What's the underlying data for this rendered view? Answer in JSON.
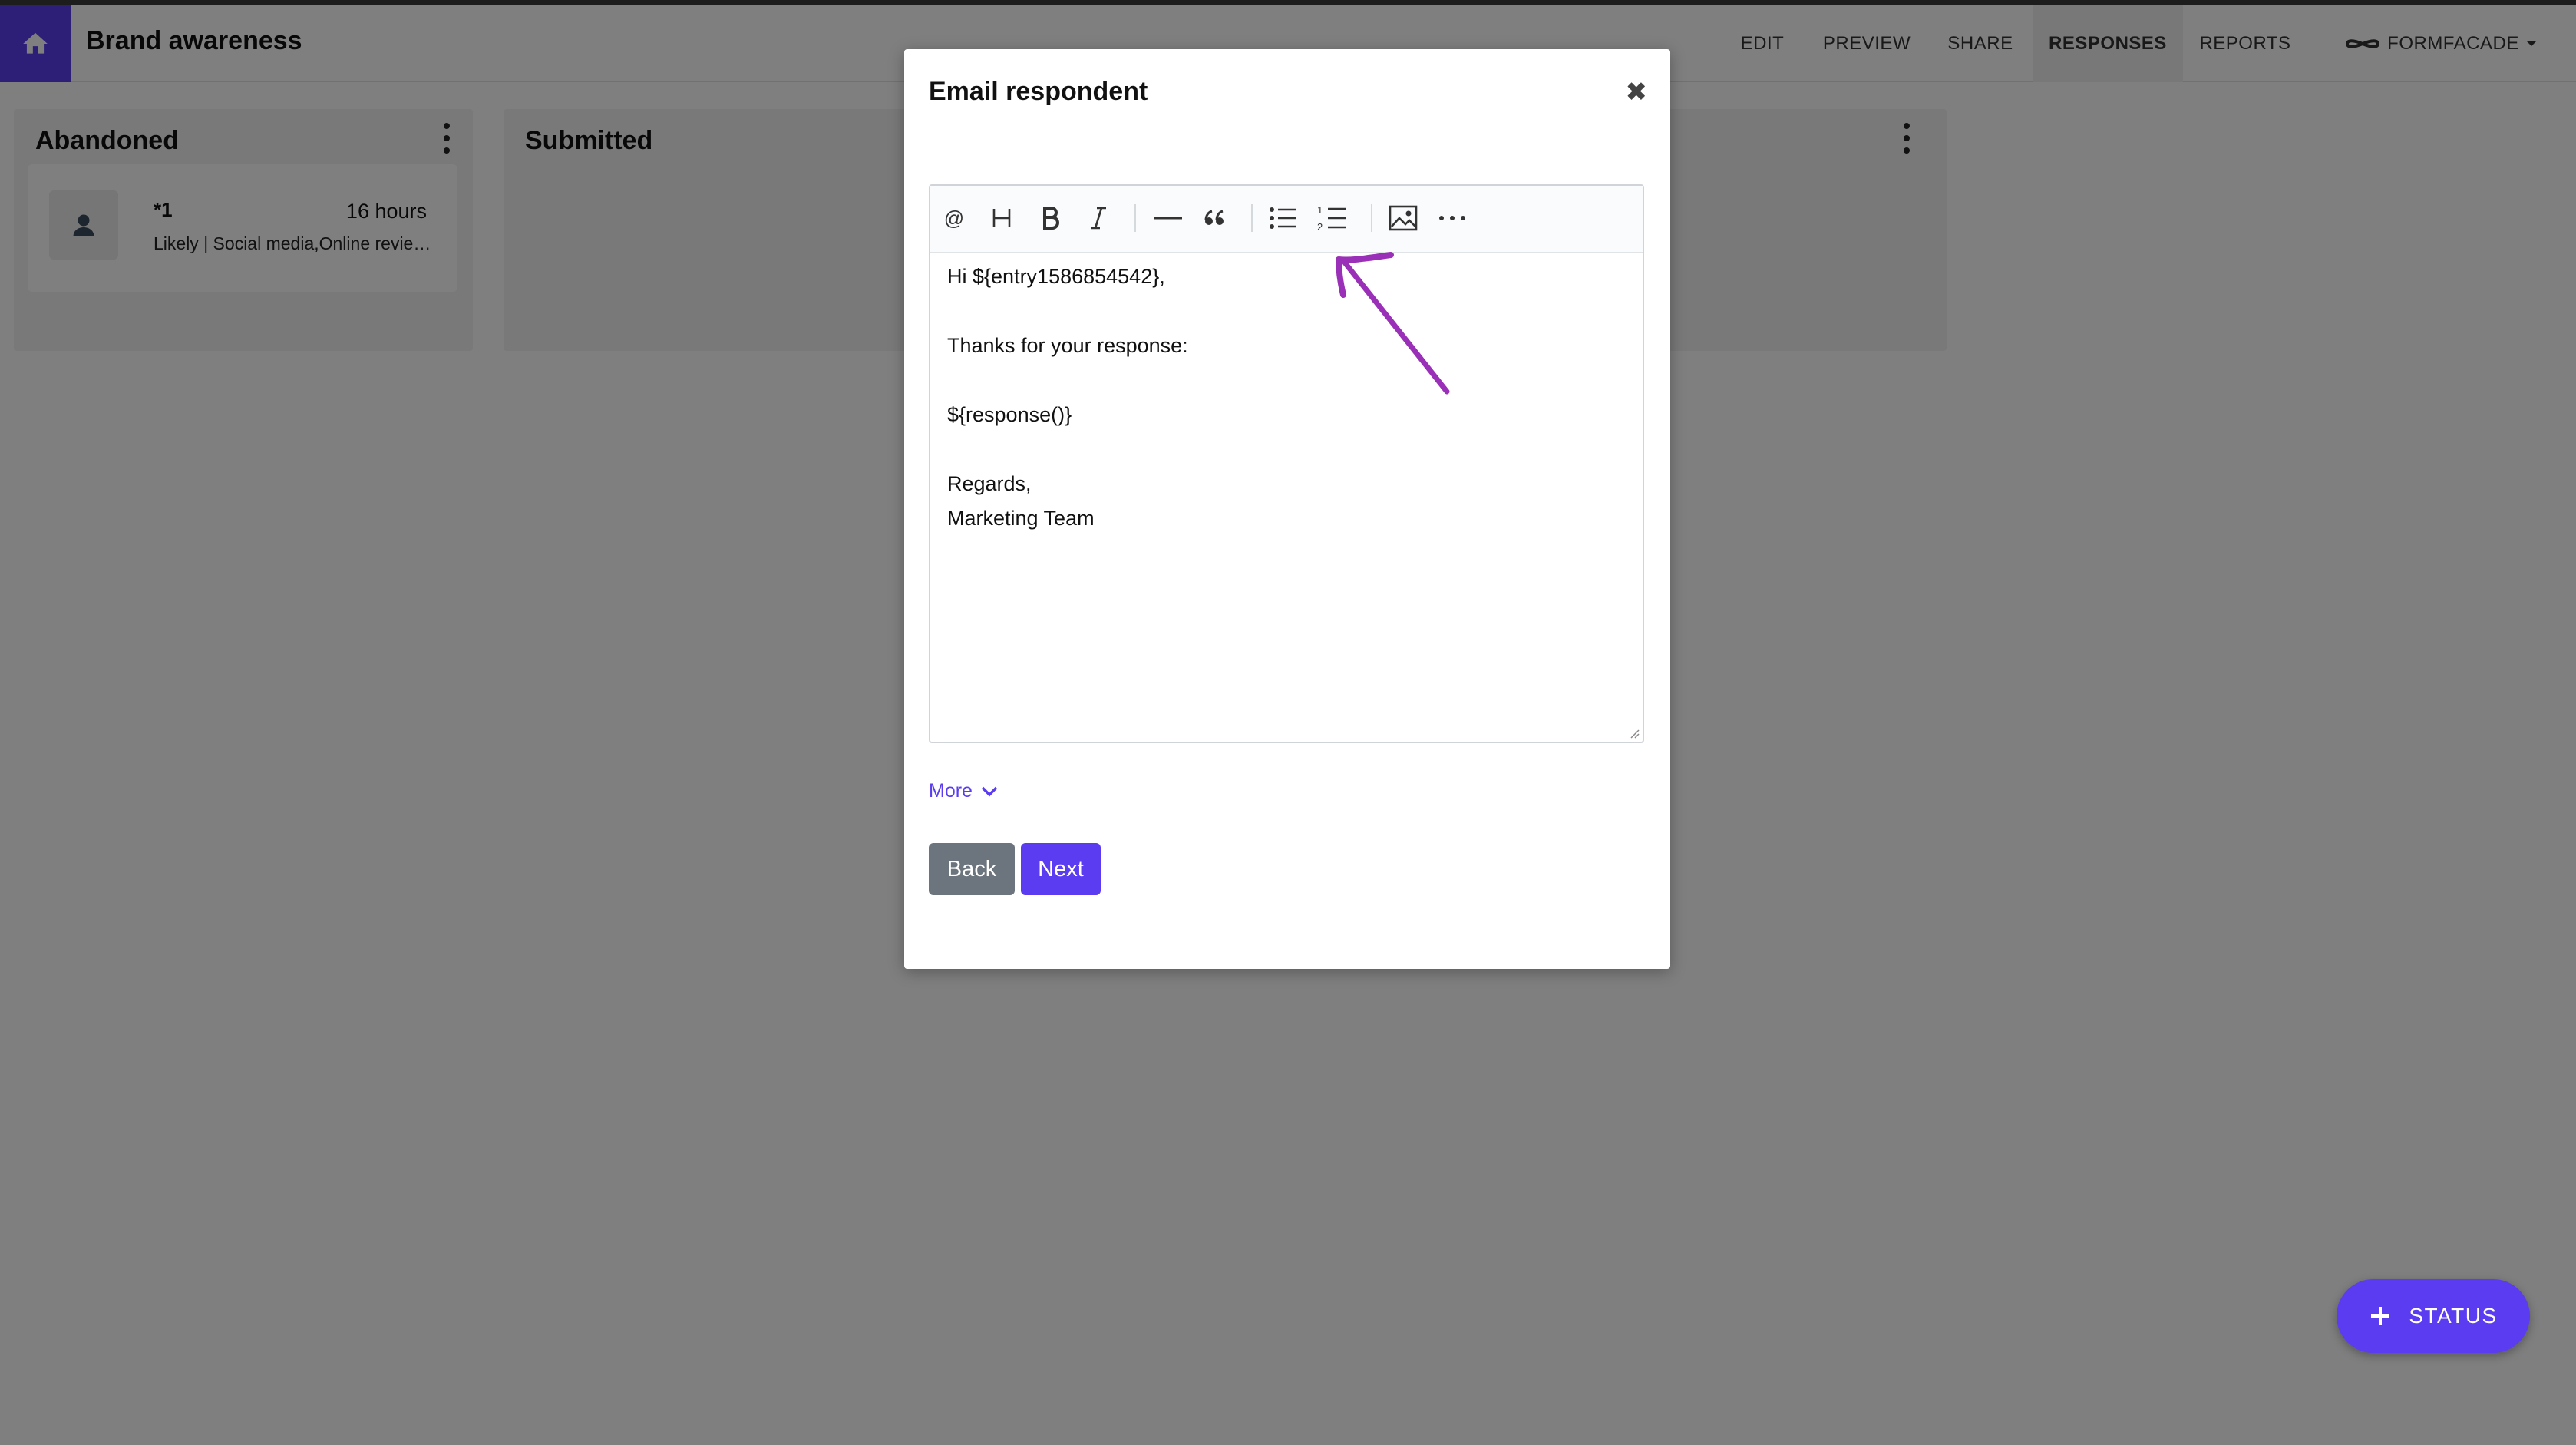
{
  "header": {
    "title": "Brand awareness",
    "nav": [
      "EDIT",
      "PREVIEW",
      "SHARE",
      "RESPONSES",
      "REPORTS"
    ],
    "brand": "FORMFACADE"
  },
  "board": {
    "columns": [
      {
        "title": "Abandoned",
        "cards": [
          {
            "title": "*1",
            "time": "16 hours",
            "summary": "Likely | Social media,Online revie…"
          }
        ]
      },
      {
        "title": "Submitted",
        "cards": []
      }
    ]
  },
  "modal": {
    "title": "Email respondent",
    "close_icon": "✖",
    "toolbar": [
      "mention",
      "heading",
      "bold",
      "italic",
      "horizontal-rule",
      "quote",
      "bullet-list",
      "numbered-list",
      "image",
      "more"
    ],
    "body_lines": [
      "Hi ${entry1586854542},",
      "",
      "Thanks for your response:",
      "",
      "${response()}",
      "",
      "Regards,",
      "Marketing Team"
    ],
    "more_label": "More",
    "back_label": "Back",
    "next_label": "Next"
  },
  "fab": {
    "label": "STATUS"
  },
  "colors": {
    "accent": "#5b3cf0",
    "annotation": "#9b30b8"
  }
}
